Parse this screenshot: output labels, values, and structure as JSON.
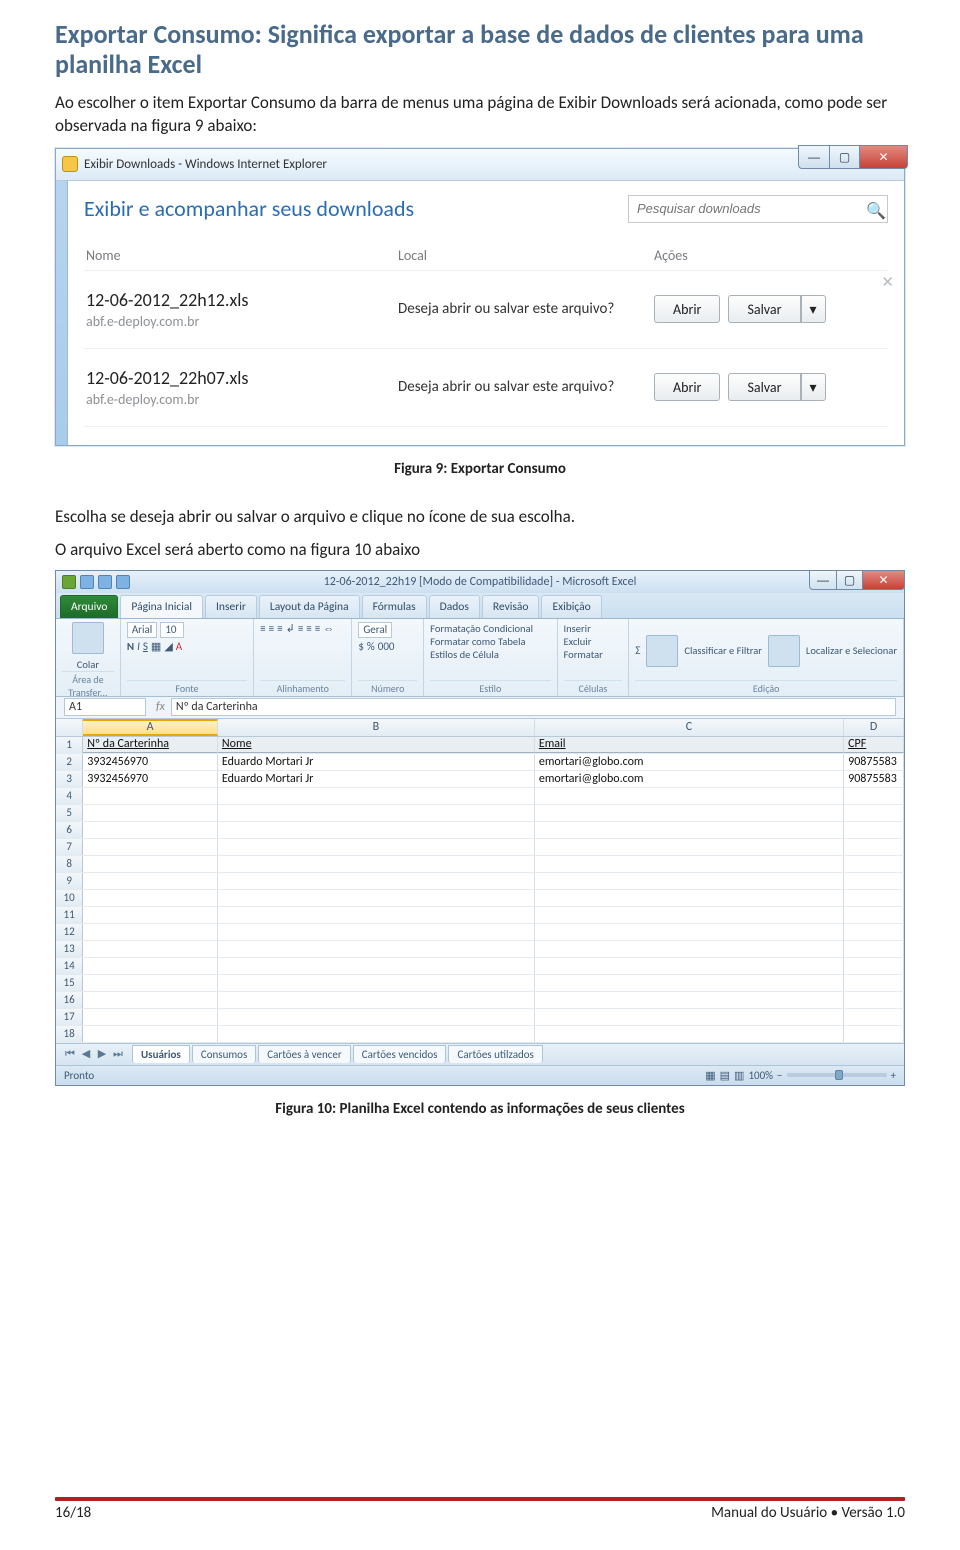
{
  "section": {
    "title": "Exportar Consumo: Significa exportar a base de dados de clientes para uma planilha Excel",
    "para1": "Ao escolher o item Exportar Consumo da barra de menus uma página de Exibir Downloads será acionada, como pode ser observada na figura 9 abaixo:",
    "caption1": "Figura 9: Exportar Consumo",
    "para2": "Escolha se deseja abrir ou salvar o arquivo e clique no ícone de sua escolha.",
    "para3": "O arquivo Excel será aberto como na figura 10 abaixo",
    "caption2": "Figura 10: Planilha Excel contendo as informações de seus clientes"
  },
  "downloads": {
    "window_title": "Exibir Downloads - Windows Internet Explorer",
    "heading": "Exibir e acompanhar seus downloads",
    "search_placeholder": "Pesquisar downloads",
    "cols": {
      "name": "Nome",
      "local": "Local",
      "actions": "Ações"
    },
    "open_btn": "Abrir",
    "save_btn": "Salvar",
    "prompt": "Deseja abrir ou salvar este arquivo?",
    "rows": [
      {
        "file": "12-06-2012_22h12.xls",
        "host": "abf.e-deploy.com.br"
      },
      {
        "file": "12-06-2012_22h07.xls",
        "host": "abf.e-deploy.com.br"
      }
    ]
  },
  "excel": {
    "title": "12-06-2012_22h19  [Modo de Compatibilidade]  -  Microsoft Excel",
    "tabs": {
      "file": "Arquivo",
      "home": "Página Inicial",
      "insert": "Inserir",
      "layout": "Layout da Página",
      "formulas": "Fórmulas",
      "data": "Dados",
      "review": "Revisão",
      "view": "Exibição"
    },
    "ribbon_groups": {
      "clipboard": "Área de Transfer...",
      "paste": "Colar",
      "font": "Fonte",
      "font_name": "Arial",
      "font_size": "10",
      "alignment": "Alinhamento",
      "number": "Número",
      "number_fmt": "Geral",
      "styles": "Estilo",
      "styles_condfmt": "Formatação Condicional",
      "styles_astable": "Formatar como Tabela",
      "styles_cell": "Estilos de Célula",
      "cells": "Células",
      "cells_insert": "Inserir",
      "cells_delete": "Excluir",
      "cells_format": "Formatar",
      "editing": "Edição",
      "editing_sort": "Classificar e Filtrar",
      "editing_find": "Localizar e Selecionar"
    },
    "namebox": "A1",
    "fx_value": "Nº da Carterinha",
    "headers": {
      "A": "A",
      "B": "B",
      "C": "C",
      "D": "D"
    },
    "row1": {
      "A": "Nº da Carterinha",
      "B": "Nome",
      "C": "Email",
      "D": "CPF"
    },
    "data_rows": [
      {
        "A": "3932456970",
        "B": "Eduardo Mortari Jr",
        "C": "emortari@globo.com",
        "D": "90875583"
      },
      {
        "A": "3932456970",
        "B": "Eduardo Mortari Jr",
        "C": "emortari@globo.com",
        "D": "90875583"
      }
    ],
    "blank_rows": 15,
    "sheets": [
      "Usuários",
      "Consumos",
      "Cartões à vencer",
      "Cartões vencidos",
      "Cartões utilzados"
    ],
    "status_ready": "Pronto",
    "zoom": "100%"
  },
  "footer": {
    "left": "16/18",
    "right": "Manual do Usuário • Versão 1.0"
  }
}
